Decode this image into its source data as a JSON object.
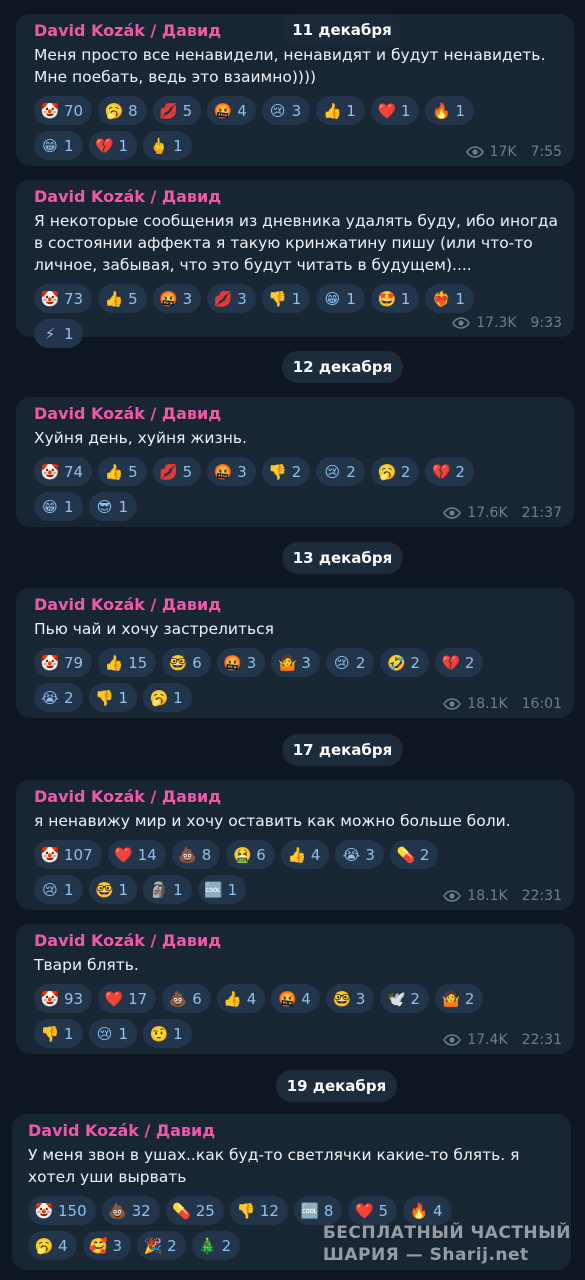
{
  "date_separators": [
    {
      "label": "11 декабря"
    },
    {
      "label": "12 декабря"
    },
    {
      "label": "13 декабря"
    },
    {
      "label": "17 декабря"
    },
    {
      "label": "19 декабря"
    }
  ],
  "messages": [
    {
      "author": "David Kozák / Давид",
      "text": "Меня просто все ненавидели, ненавидят и будут ненавидеть.\nМне поебать, ведь это взаимно))))",
      "views": "17K",
      "time": "7:55",
      "reactions": [
        {
          "emoji": "🤡",
          "count": "70",
          "icon": "clown-icon"
        },
        {
          "emoji": "🥱",
          "count": "8",
          "icon": "yawn-icon"
        },
        {
          "emoji": "💋",
          "count": "5",
          "icon": "kiss-mark-icon"
        },
        {
          "emoji": "🤬",
          "count": "4",
          "icon": "cursing-face-icon"
        },
        {
          "emoji": "😢",
          "count": "3",
          "icon": "crying-face-icon"
        },
        {
          "emoji": "👍",
          "count": "1",
          "icon": "thumbs-up-icon"
        },
        {
          "emoji": "❤️",
          "count": "1",
          "icon": "red-heart-icon"
        },
        {
          "emoji": "🔥",
          "count": "1",
          "icon": "fire-icon"
        },
        {
          "emoji": "😁",
          "count": "1",
          "icon": "grin-icon"
        },
        {
          "emoji": "💔",
          "count": "1",
          "icon": "broken-heart-icon"
        },
        {
          "emoji": "🖕",
          "count": "1",
          "icon": "middle-finger-icon"
        }
      ]
    },
    {
      "author": "David Kozák / Давид",
      "text": "Я некоторые сообщения из дневника удалять буду, ибо иногда в состоянии аффекта я такую кринжатину пишу (или что-то личное, забывая, что это будут читать в будущем)....",
      "views": "17.3K",
      "time": "9:33",
      "reactions": [
        {
          "emoji": "🤡",
          "count": "73",
          "icon": "clown-icon"
        },
        {
          "emoji": "👍",
          "count": "5",
          "icon": "thumbs-up-icon"
        },
        {
          "emoji": "🤬",
          "count": "3",
          "icon": "cursing-face-icon"
        },
        {
          "emoji": "💋",
          "count": "3",
          "icon": "kiss-mark-icon"
        },
        {
          "emoji": "👎",
          "count": "1",
          "icon": "thumbs-down-icon"
        },
        {
          "emoji": "😁",
          "count": "1",
          "icon": "grin-icon"
        },
        {
          "emoji": "🤩",
          "count": "1",
          "icon": "star-struck-icon"
        },
        {
          "emoji": "❤️‍🔥",
          "count": "1",
          "icon": "heart-on-fire-icon"
        },
        {
          "emoji": "⚡",
          "count": "1",
          "icon": "lightning-icon"
        }
      ]
    },
    {
      "author": "David Kozák / Давид",
      "text": "Хуйня день, хуйня жизнь.",
      "views": "17.6K",
      "time": "21:37",
      "reactions": [
        {
          "emoji": "🤡",
          "count": "74",
          "icon": "clown-icon"
        },
        {
          "emoji": "👍",
          "count": "5",
          "icon": "thumbs-up-icon"
        },
        {
          "emoji": "💋",
          "count": "5",
          "icon": "kiss-mark-icon"
        },
        {
          "emoji": "🤬",
          "count": "3",
          "icon": "cursing-face-icon"
        },
        {
          "emoji": "👎",
          "count": "2",
          "icon": "thumbs-down-icon"
        },
        {
          "emoji": "😢",
          "count": "2",
          "icon": "crying-face-icon"
        },
        {
          "emoji": "🥱",
          "count": "2",
          "icon": "yawn-icon"
        },
        {
          "emoji": "💔",
          "count": "2",
          "icon": "broken-heart-icon"
        },
        {
          "emoji": "😁",
          "count": "1",
          "icon": "grin-icon"
        },
        {
          "emoji": "😎",
          "count": "1",
          "icon": "sunglasses-face-icon"
        }
      ]
    },
    {
      "author": "David Kozák / Давид",
      "text": "Пью чай и хочу застрелиться",
      "views": "18.1K",
      "time": "16:01",
      "reactions": [
        {
          "emoji": "🤡",
          "count": "79",
          "icon": "clown-icon"
        },
        {
          "emoji": "👍",
          "count": "15",
          "icon": "thumbs-up-icon"
        },
        {
          "emoji": "🤓",
          "count": "6",
          "icon": "nerd-face-icon"
        },
        {
          "emoji": "🤬",
          "count": "3",
          "icon": "cursing-face-icon"
        },
        {
          "emoji": "🤷",
          "count": "3",
          "icon": "shrug-icon"
        },
        {
          "emoji": "😢",
          "count": "2",
          "icon": "crying-face-icon"
        },
        {
          "emoji": "🤣",
          "count": "2",
          "icon": "rofl-icon"
        },
        {
          "emoji": "💔",
          "count": "2",
          "icon": "broken-heart-icon"
        },
        {
          "emoji": "😭",
          "count": "2",
          "icon": "sobbing-face-icon"
        },
        {
          "emoji": "👎",
          "count": "1",
          "icon": "thumbs-down-icon"
        },
        {
          "emoji": "🥱",
          "count": "1",
          "icon": "yawn-icon"
        }
      ]
    },
    {
      "author": "David Kozák / Давид",
      "text": "я ненавижу мир и хочу оставить как можно больше боли.",
      "views": "18.1K",
      "time": "22:31",
      "reactions": [
        {
          "emoji": "🤡",
          "count": "107",
          "icon": "clown-icon"
        },
        {
          "emoji": "❤️",
          "count": "14",
          "icon": "red-heart-icon"
        },
        {
          "emoji": "💩",
          "count": "8",
          "icon": "poop-icon"
        },
        {
          "emoji": "🤮",
          "count": "6",
          "icon": "vomiting-face-icon"
        },
        {
          "emoji": "👍",
          "count": "4",
          "icon": "thumbs-up-icon"
        },
        {
          "emoji": "😭",
          "count": "3",
          "icon": "sobbing-face-icon"
        },
        {
          "emoji": "💊",
          "count": "2",
          "icon": "pill-icon"
        },
        {
          "emoji": "😢",
          "count": "1",
          "icon": "crying-face-icon"
        },
        {
          "emoji": "🤓",
          "count": "1",
          "icon": "nerd-face-icon"
        },
        {
          "emoji": "🗿",
          "count": "1",
          "icon": "moai-icon"
        },
        {
          "emoji": "🆒",
          "count": "1",
          "icon": "cool-button-icon"
        }
      ]
    },
    {
      "author": "David Kozák / Давид",
      "text": "Твари блять.",
      "views": "17.4K",
      "time": "22:31",
      "reactions": [
        {
          "emoji": "🤡",
          "count": "93",
          "icon": "clown-icon"
        },
        {
          "emoji": "❤️",
          "count": "17",
          "icon": "red-heart-icon"
        },
        {
          "emoji": "💩",
          "count": "6",
          "icon": "poop-icon"
        },
        {
          "emoji": "👍",
          "count": "4",
          "icon": "thumbs-up-icon"
        },
        {
          "emoji": "🤬",
          "count": "4",
          "icon": "cursing-face-icon"
        },
        {
          "emoji": "🤓",
          "count": "3",
          "icon": "nerd-face-icon"
        },
        {
          "emoji": "🕊️",
          "count": "2",
          "icon": "dove-icon"
        },
        {
          "emoji": "🤷",
          "count": "2",
          "icon": "shrug-icon"
        },
        {
          "emoji": "👎",
          "count": "1",
          "icon": "thumbs-down-icon"
        },
        {
          "emoji": "😢",
          "count": "1",
          "icon": "crying-face-icon"
        },
        {
          "emoji": "🤨",
          "count": "1",
          "icon": "raised-eyebrow-icon"
        }
      ]
    },
    {
      "author": "David Kozák / Давид",
      "text": "У меня звон в ушах..как буд-то светлячки какие-то блять. я хотел уши вырвать",
      "views": "",
      "time": "",
      "reactions": [
        {
          "emoji": "🤡",
          "count": "150",
          "icon": "clown-icon"
        },
        {
          "emoji": "💩",
          "count": "32",
          "icon": "poop-icon"
        },
        {
          "emoji": "💊",
          "count": "25",
          "icon": "pill-icon"
        },
        {
          "emoji": "👎",
          "count": "12",
          "icon": "thumbs-down-icon"
        },
        {
          "emoji": "🆒",
          "count": "8",
          "icon": "cool-button-icon"
        },
        {
          "emoji": "❤️",
          "count": "5",
          "icon": "red-heart-icon"
        },
        {
          "emoji": "🔥",
          "count": "4",
          "icon": "fire-icon"
        },
        {
          "emoji": "🥱",
          "count": "4",
          "icon": "yawn-icon"
        },
        {
          "emoji": "🥰",
          "count": "3",
          "icon": "smiling-hearts-icon"
        },
        {
          "emoji": "🎉",
          "count": "2",
          "icon": "party-popper-icon"
        },
        {
          "emoji": "🎄",
          "count": "2",
          "icon": "christmas-tree-icon"
        }
      ]
    }
  ],
  "watermark": {
    "line1": "БЕСПЛАТНЫЙ ЧАСТНЫЙ",
    "line2": "ШАРИЯ — Sharij.net"
  },
  "colors": {
    "background": "#0e1621",
    "bubble": "#182533",
    "author": "#ee5aa8",
    "reaction_bg": "#23354a",
    "reaction_count": "#8fc0ef",
    "meta": "#6d7f8f"
  }
}
